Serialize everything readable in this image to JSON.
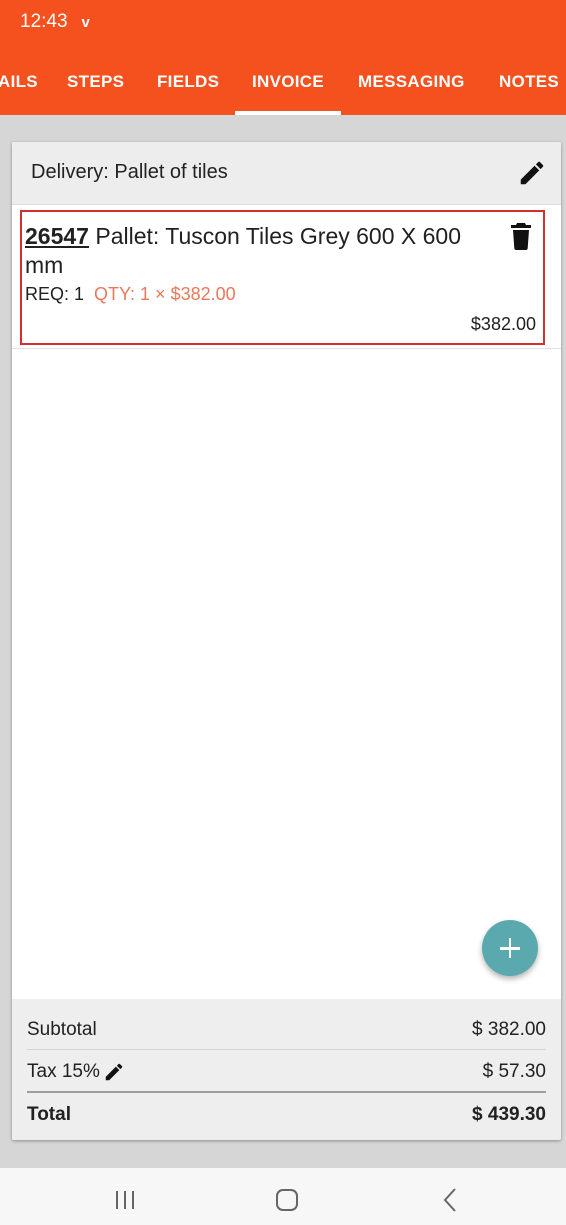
{
  "status_bar": {
    "time": "12:43",
    "indicator": "v"
  },
  "tabs": [
    {
      "label": "AILS",
      "name": "tab-details"
    },
    {
      "label": "STEPS",
      "name": "tab-steps"
    },
    {
      "label": "FIELDS",
      "name": "tab-fields"
    },
    {
      "label": "INVOICE",
      "name": "tab-invoice",
      "active": true
    },
    {
      "label": "MESSAGING",
      "name": "tab-messaging"
    },
    {
      "label": "NOTES",
      "name": "tab-notes"
    }
  ],
  "card": {
    "title": "Delivery: Pallet of tiles",
    "edit_icon": "pencil-icon"
  },
  "line_items": [
    {
      "code": "26547",
      "description": " Pallet: Tuscon Tiles Grey 600 X 600 mm",
      "req": "REQ: 1",
      "qty": "QTY: 1 × $382.00",
      "price": "$382.00",
      "delete_icon": "trash-icon"
    }
  ],
  "add_button_icon": "plus-icon",
  "totals": {
    "subtotal_label": "Subtotal",
    "subtotal_value": "$ 382.00",
    "tax_label": "Tax 15%",
    "tax_value": "$ 57.30",
    "total_label": "Total",
    "total_value": "$ 439.30"
  },
  "colors": {
    "brand": "#f4511e",
    "accent_fab": "#5aa9ae",
    "qty_text": "#e8795a",
    "highlight_border": "#d32f2f"
  },
  "nav_bar": {
    "icons": [
      "recent-apps-icon",
      "home-icon",
      "back-icon"
    ]
  }
}
